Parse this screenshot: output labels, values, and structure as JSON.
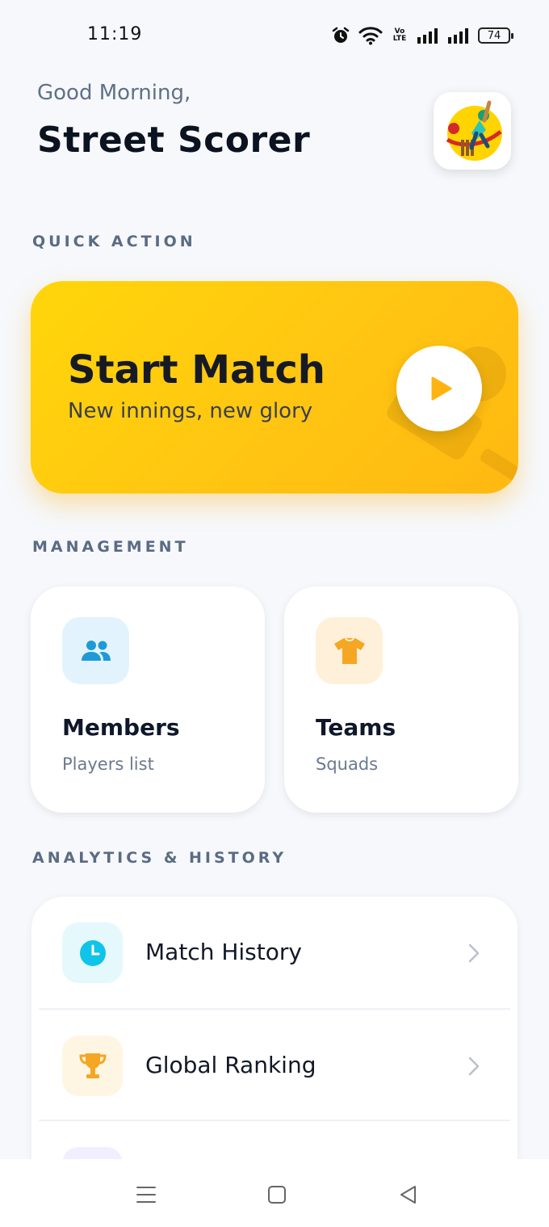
{
  "status_bar": {
    "time": "11:19",
    "volte": "Vo LTE",
    "battery": "74"
  },
  "header": {
    "greeting": "Good Morning,",
    "app_name": "Street Scorer",
    "avatar_icon": "cricket-batsman-logo"
  },
  "quick_action": {
    "section_label": "QUICK ACTION",
    "title": "Start Match",
    "subtitle": "New innings, new glory",
    "icon": "play-icon",
    "accent": "#ffc512"
  },
  "management": {
    "section_label": "MANAGEMENT",
    "cards": [
      {
        "title": "Members",
        "subtitle": "Players list",
        "icon": "people-icon",
        "color": "#1e9bd7",
        "bg": "#e3f3fd"
      },
      {
        "title": "Teams",
        "subtitle": "Squads",
        "icon": "tshirt-icon",
        "color": "#f5a623",
        "bg": "#fff0d9"
      }
    ]
  },
  "analytics": {
    "section_label": "ANALYTICS & HISTORY",
    "items": [
      {
        "label": "Match History",
        "icon": "clock-icon",
        "color": "#0fc4e8",
        "bg": "#e5f8fc"
      },
      {
        "label": "Global Ranking",
        "icon": "trophy-icon",
        "color": "#f5a623",
        "bg": "#fff5e3"
      }
    ]
  },
  "nav": {
    "menu_icon": "menu-icon",
    "home_icon": "home-square-icon",
    "back_icon": "back-triangle-icon"
  }
}
